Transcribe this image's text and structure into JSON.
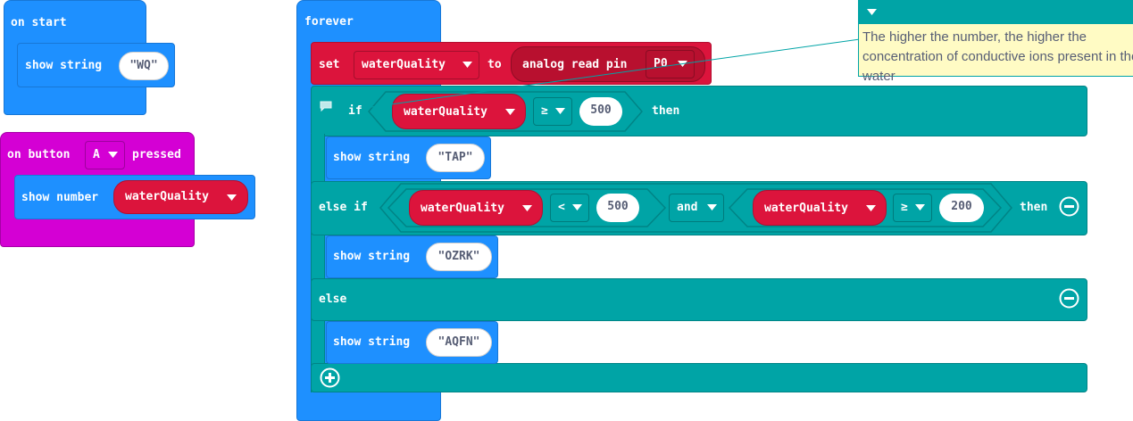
{
  "on_start": {
    "label": "on start",
    "show_string": {
      "label": "show string",
      "value": "WQ"
    }
  },
  "on_button": {
    "prefix": "on button",
    "button": "A",
    "suffix": "pressed",
    "show_number": {
      "label": "show number",
      "variable": "waterQuality"
    }
  },
  "forever": {
    "label": "forever",
    "set": {
      "label": "set",
      "variable": "waterQuality",
      "to_label": "to",
      "reader": "analog read pin",
      "pin": "P0"
    },
    "if_block": {
      "if_label": "if",
      "then_label": "then",
      "condition": {
        "variable": "waterQuality",
        "operator": "≥",
        "value": "500"
      },
      "show_string": {
        "label": "show string",
        "value": "TAP"
      }
    },
    "else_if_block": {
      "label": "else if",
      "then_label": "then",
      "left": {
        "variable": "waterQuality",
        "operator": "<",
        "value": "500"
      },
      "logic": "and",
      "right": {
        "variable": "waterQuality",
        "operator": "≥",
        "value": "200"
      },
      "show_string": {
        "label": "show string",
        "value": "OZRK"
      }
    },
    "else_block": {
      "label": "else",
      "show_string": {
        "label": "show string",
        "value": "AQFN"
      }
    }
  },
  "comment": {
    "text": "The higher the number, the higher the concentration of conductive ions present in the water"
  },
  "icons": [
    "dropdown-arrow-icon",
    "comment-icon",
    "remove-circle-icon",
    "add-circle-icon"
  ],
  "colors": {
    "basic": "#1e90ff",
    "input": "#d400d4",
    "variables": "#dc143c",
    "logic": "#00a4a6",
    "comment_bg": "#fffbc4"
  }
}
